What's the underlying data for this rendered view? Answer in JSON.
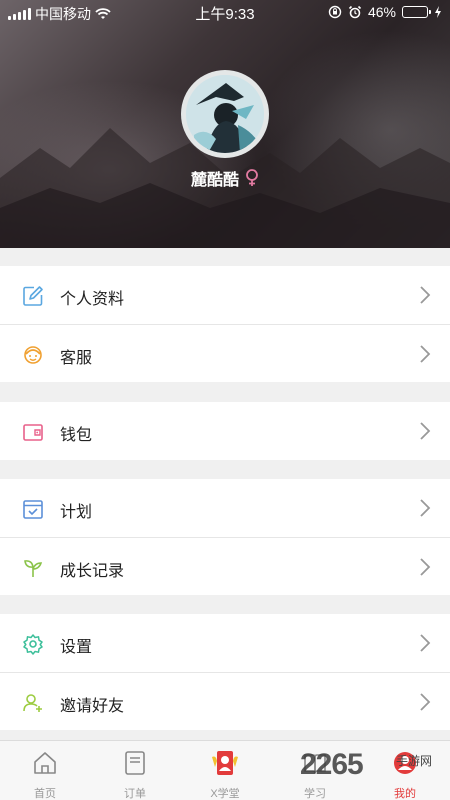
{
  "status_bar": {
    "carrier": "中国移动",
    "time": "上午9:33",
    "battery": "46%",
    "battery_level": 0.46,
    "icons": [
      "signal-icon",
      "wifi-icon",
      "orientation-lock-icon",
      "alarm-icon",
      "battery-icon",
      "charging-icon"
    ]
  },
  "profile": {
    "username": "麓酷酷",
    "gender_icon": "female-icon"
  },
  "menu": {
    "groups": [
      {
        "items": [
          {
            "label": "个人资料",
            "icon": "edit-icon"
          },
          {
            "label": "客服",
            "icon": "customer-service-icon"
          }
        ]
      },
      {
        "items": [
          {
            "label": "钱包",
            "icon": "wallet-icon"
          }
        ]
      },
      {
        "items": [
          {
            "label": "计划",
            "icon": "calendar-icon"
          },
          {
            "label": "成长记录",
            "icon": "sprout-icon"
          }
        ]
      },
      {
        "items": [
          {
            "label": "设置",
            "icon": "gear-icon"
          },
          {
            "label": "邀请好友",
            "icon": "add-friend-icon"
          }
        ]
      }
    ]
  },
  "tabbar": {
    "tabs": [
      {
        "label": "首页",
        "icon": "home-icon"
      },
      {
        "label": "订单",
        "icon": "order-icon"
      },
      {
        "label": "X学堂",
        "icon": "classroom-icon"
      },
      {
        "label": "学习",
        "icon": "study-icon"
      },
      {
        "label": "我的",
        "icon": "profile-icon",
        "active": true
      }
    ]
  },
  "watermark": {
    "brand": "2265",
    "sub": "手游网"
  },
  "colors": {
    "accent": "#e23b3b",
    "female": "#e27aa0"
  }
}
